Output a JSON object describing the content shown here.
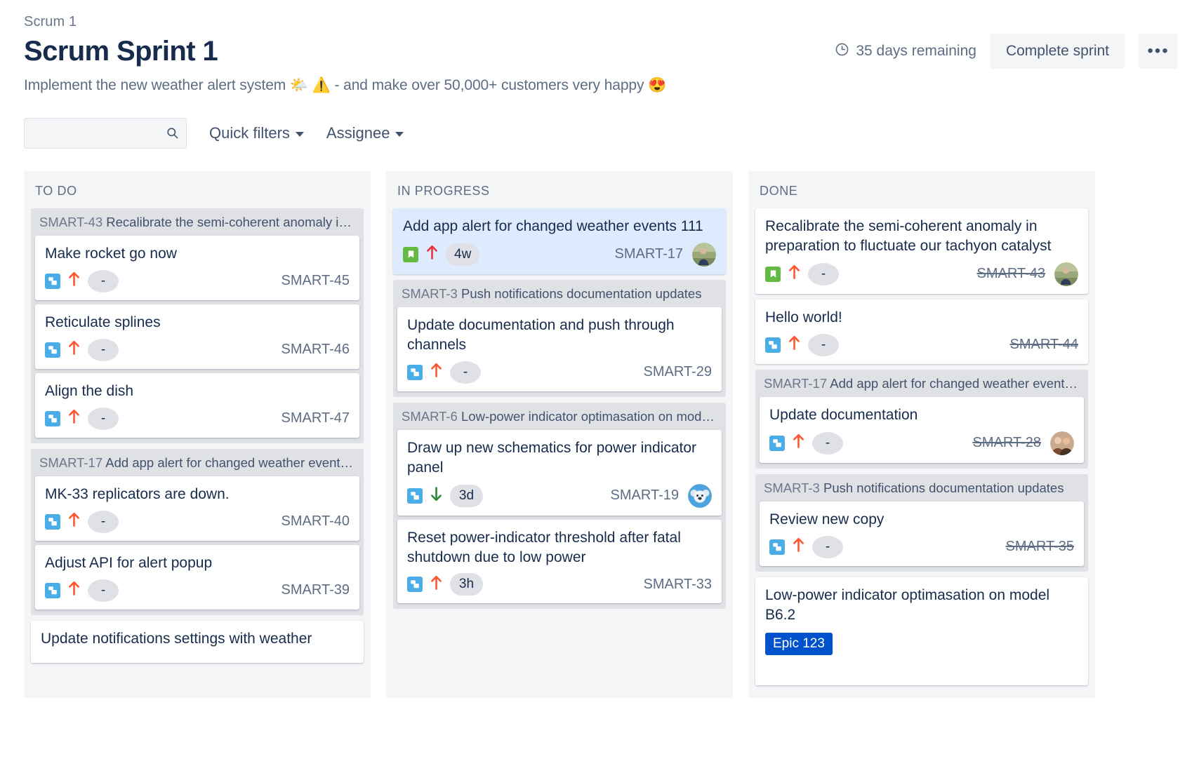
{
  "header": {
    "breadcrumb": "Scrum 1",
    "title": "Scrum Sprint 1",
    "goal": "Implement the new weather alert system 🌤️ ⚠️  - and make over 50,000+ customers very happy 😍",
    "days_remaining": "35 days remaining",
    "complete_sprint_label": "Complete sprint",
    "more_label": "•••",
    "clock_icon": "clock-icon",
    "more_icon": "ellipsis-icon"
  },
  "filters": {
    "search_value": "",
    "search_placeholder": "",
    "search_icon": "search-icon",
    "quick_filters_label": "Quick filters",
    "assignee_label": "Assignee",
    "caret_icon": "chevron-down-icon"
  },
  "colors": {
    "accent": "#0052cc",
    "story": "#65ba43",
    "subtask": "#4bade8",
    "priority_high": "#ff5630",
    "priority_highest": "#e8333a",
    "priority_low": "#2d8738",
    "selected_card": "#deebff",
    "column_bg": "#f4f5f7",
    "group_bg": "#dfe1e5"
  },
  "columns": [
    {
      "name": "TO DO",
      "groups": [
        {
          "type": "group",
          "key": "SMART-43",
          "summary": "Recalibrate the semi-coherent anomaly i…",
          "cards": [
            {
              "title": "Make rocket go now",
              "type": "subtask",
              "priority": "up",
              "priority_color": "#ff5630",
              "estimate": "-",
              "estimate_kind": "avatar-dash",
              "key": "SMART-45",
              "done": false,
              "avatar": "none"
            },
            {
              "title": "Reticulate splines",
              "type": "subtask",
              "priority": "up",
              "priority_color": "#ff5630",
              "estimate": "-",
              "estimate_kind": "avatar-dash",
              "key": "SMART-46",
              "done": false,
              "avatar": "none"
            },
            {
              "title": "Align the dish",
              "type": "subtask",
              "priority": "up",
              "priority_color": "#ff5630",
              "estimate": "-",
              "estimate_kind": "avatar-dash",
              "key": "SMART-47",
              "done": false,
              "avatar": "none"
            }
          ]
        },
        {
          "type": "group",
          "key": "SMART-17",
          "summary": "Add app alert for changed weather event…",
          "cards": [
            {
              "title": "MK-33 replicators are down.",
              "type": "subtask",
              "priority": "up",
              "priority_color": "#ff5630",
              "estimate": "-",
              "estimate_kind": "avatar-dash",
              "key": "SMART-40",
              "done": false,
              "avatar": "none"
            },
            {
              "title": "Adjust API for alert popup",
              "type": "subtask",
              "priority": "up",
              "priority_color": "#ff5630",
              "estimate": "-",
              "estimate_kind": "avatar-dash",
              "key": "SMART-39",
              "done": false,
              "avatar": "none"
            }
          ]
        },
        {
          "type": "card",
          "card": {
            "title": "Update notifications settings with weather",
            "type": "none",
            "priority": "none",
            "estimate": "",
            "estimate_kind": "none",
            "key": "",
            "done": false,
            "avatar": "none"
          }
        }
      ]
    },
    {
      "name": "IN PROGRESS",
      "groups": [
        {
          "type": "card",
          "card": {
            "title": "Add app alert for changed weather events 111",
            "type": "story",
            "priority": "up",
            "priority_color": "#e8333a",
            "estimate": "4w",
            "estimate_kind": "pill",
            "key": "SMART-17",
            "done": false,
            "avatar": "photo-person",
            "selected": true
          }
        },
        {
          "type": "group",
          "key": "SMART-3",
          "summary": "Push notifications documentation updates",
          "cards": [
            {
              "title": "Update documentation and push through channels",
              "type": "subtask",
              "priority": "up",
              "priority_color": "#ff5630",
              "estimate": "-",
              "estimate_kind": "avatar-dash",
              "key": "SMART-29",
              "done": false,
              "avatar": "none"
            }
          ]
        },
        {
          "type": "group",
          "key": "SMART-6",
          "summary": "Low-power indicator optimasation on mod…",
          "cards": [
            {
              "title": "Draw up new schematics for power indicator panel",
              "type": "subtask",
              "priority": "down",
              "priority_color": "#2d8738",
              "estimate": "3d",
              "estimate_kind": "pill",
              "key": "SMART-19",
              "done": false,
              "avatar": "koala"
            },
            {
              "title": "Reset power-indicator threshold after fatal shutdown due to low power",
              "type": "subtask",
              "priority": "up",
              "priority_color": "#ff5630",
              "estimate": "3h",
              "estimate_kind": "pill",
              "key": "SMART-33",
              "done": false,
              "avatar": "none"
            }
          ]
        }
      ]
    },
    {
      "name": "DONE",
      "groups": [
        {
          "type": "card",
          "card": {
            "title": "Recalibrate the semi-coherent anomaly in preparation to fluctuate our tachyon catalyst",
            "type": "story",
            "priority": "up",
            "priority_color": "#ff5630",
            "estimate": "-",
            "estimate_kind": "avatar-dash",
            "key": "SMART-43",
            "done": true,
            "avatar": "photo-person"
          }
        },
        {
          "type": "card",
          "card": {
            "title": "Hello world!",
            "type": "subtask",
            "priority": "up",
            "priority_color": "#ff5630",
            "estimate": "-",
            "estimate_kind": "avatar-dash",
            "key": "SMART-44",
            "done": true,
            "avatar": "none"
          }
        },
        {
          "type": "group",
          "key": "SMART-17",
          "summary": "Add app alert for changed weather event…",
          "cards": [
            {
              "title": "Update documentation",
              "type": "subtask",
              "priority": "up",
              "priority_color": "#ff5630",
              "estimate": "-",
              "estimate_kind": "avatar-dash",
              "key": "SMART-28",
              "done": true,
              "avatar": "photo-couple"
            }
          ]
        },
        {
          "type": "group",
          "key": "SMART-3",
          "summary": "Push notifications documentation updates",
          "cards": [
            {
              "title": "Review new copy",
              "type": "subtask",
              "priority": "up",
              "priority_color": "#ff5630",
              "estimate": "-",
              "estimate_kind": "avatar-dash",
              "key": "SMART-35",
              "done": true,
              "avatar": "none"
            }
          ]
        },
        {
          "type": "card",
          "card": {
            "title": "Low-power indicator optimasation on model B6.2",
            "type": "none",
            "priority": "none",
            "estimate": "",
            "estimate_kind": "none",
            "key": "",
            "done": false,
            "avatar": "none",
            "epic_badge": "Epic 123"
          }
        }
      ]
    }
  ]
}
